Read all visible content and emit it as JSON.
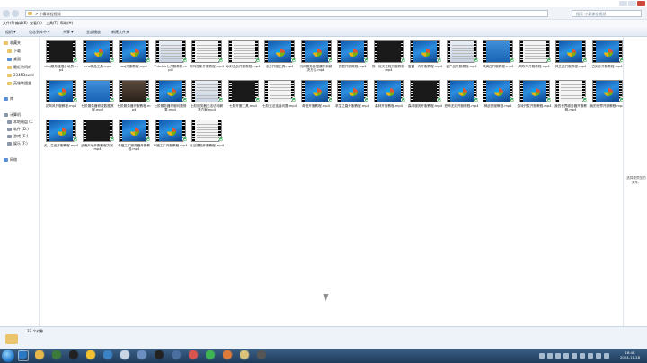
{
  "window": {
    "address_path": "> 小泰课程视频",
    "search_placeholder": "搜索 小泰课程视频"
  },
  "menu": [
    "文件(F)",
    "编辑(E)",
    "查看(V)",
    "工具(T)",
    "帮助(H)"
  ],
  "toolbar": [
    "组织 ▾",
    "包含到库中 ▾",
    "共享 ▾",
    "全部播放",
    "新建文件夹"
  ],
  "sidebar": [
    {
      "label": "收藏夹",
      "icon": "star-icon"
    },
    {
      "label": "下载",
      "icon": "folder-icon"
    },
    {
      "label": "桌面",
      "icon": "desktop-icon"
    },
    {
      "label": "最近访问的",
      "icon": "recent-icon"
    },
    {
      "label": "2345Downl",
      "icon": "folder-icon"
    },
    {
      "label": "英雄联盟盒",
      "icon": "folder-icon"
    },
    {
      "label": "库",
      "icon": "library-icon"
    },
    {
      "label": "计算机",
      "icon": "computer-icon"
    },
    {
      "label": "本地磁盘 (C",
      "icon": "drive-icon"
    },
    {
      "label": "软件 (D:)",
      "icon": "drive-icon"
    },
    {
      "label": "游戏 (E:)",
      "icon": "drive-icon"
    },
    {
      "label": "娱乐 (F:)",
      "icon": "drive-icon"
    },
    {
      "label": "网络",
      "icon": "network-icon"
    }
  ],
  "files": [
    {
      "name": "dnsj服务器混合动员.mp4",
      "thumb": "black"
    },
    {
      "name": "mns精品工具.mp4",
      "thumb": "win7"
    },
    {
      "name": "wxj开服教程.mp4",
      "thumb": "win7"
    },
    {
      "name": "千dx-blz七开服教程.mp4",
      "thumb": "ui"
    },
    {
      "name": "阿玛拉斯开服教程.mp4",
      "thumb": "white"
    },
    {
      "name": "冰封之战开服教程.mp4",
      "thumb": "white"
    },
    {
      "name": "沧方开服工具.mp4",
      "thumb": "win7"
    },
    {
      "name": "沉闷服务器搭建不到解决方法.mp4",
      "thumb": "win7"
    },
    {
      "name": "仇恨开服教程.mp4",
      "thumb": "win7"
    },
    {
      "name": "夜一帐天工程开服教程.mp4",
      "thumb": "black"
    },
    {
      "name": "富僧一舟开服教程.mp4",
      "thumb": "win7"
    },
    {
      "name": "盛产品开服教程.mp4",
      "thumb": "ui"
    },
    {
      "name": "风满西开服教程.mp4",
      "thumb": "study"
    },
    {
      "name": "风吹牛开服教程.mp4",
      "thumb": "white"
    },
    {
      "name": "风之西开服教程.mp4",
      "thumb": "win7"
    },
    {
      "name": "古剑诊开服教程.mp4",
      "thumb": "win7"
    },
    {
      "name": "花风风开服教程.mp4",
      "thumb": "win7"
    },
    {
      "name": "七阶服务器修改数据教程.mp4",
      "thumb": "study"
    },
    {
      "name": "七阶服务器开服教程.mp4",
      "thumb": "photo"
    },
    {
      "name": "七阶服务器开服问题修复.mp4",
      "thumb": "win7"
    },
    {
      "name": "七阶服务器无法访问解决方案.mp4",
      "thumb": "ui"
    },
    {
      "name": "七阶开服工具.mp4",
      "thumb": "black"
    },
    {
      "name": "七阶无法连接问题.mp4",
      "thumb": "white"
    },
    {
      "name": "奇迹开服教程.mp4",
      "thumb": "win7"
    },
    {
      "name": "求生之路开服教程.mp4",
      "thumb": "win7"
    },
    {
      "name": "森林开服教程.mp4",
      "thumb": "win7"
    },
    {
      "name": "森林服务开服教程.mp4",
      "thumb": "black"
    },
    {
      "name": "恐怖无双开服教程.mp4",
      "thumb": "win7"
    },
    {
      "name": "神武开服教程.mp4",
      "thumb": "win7"
    },
    {
      "name": "游戏开发开服教程.mp4",
      "thumb": "win7"
    },
    {
      "name": "我的世界服务器开服教程.mp4",
      "thumb": "white"
    },
    {
      "name": "我的世界开服教程.mp4",
      "thumb": "win7"
    },
    {
      "name": "无人生还开服教程.mp4",
      "thumb": "win7"
    },
    {
      "name": "武魂天地开服教程方案.mp4",
      "thumb": "black"
    },
    {
      "name": "幸福工厂服务器开服教程.mp4",
      "thumb": "win7"
    },
    {
      "name": "幸福工厂开服教程.mp4",
      "thumb": "win7"
    },
    {
      "name": "自己搭配开服教程.mp4",
      "thumb": "white"
    }
  ],
  "preview_text": "选择要预览的文件。",
  "status": {
    "item_count": "37 个对象"
  },
  "taskbar": {
    "icons": [
      "ie-icon",
      "folder-icon",
      "chrome-icon",
      "steam-icon",
      "qq-icon",
      "app-icon",
      "app-icon",
      "app-icon",
      "penguin-icon",
      "app-icon",
      "app-icon",
      "edge-icon",
      "app-icon",
      "app-icon",
      "app-icon"
    ],
    "time": "18:48",
    "date": "2024-11-28"
  },
  "colors": {
    "accent": "#1c6fc2",
    "check": "#34a853",
    "taskbar": "#1f3b5a"
  }
}
